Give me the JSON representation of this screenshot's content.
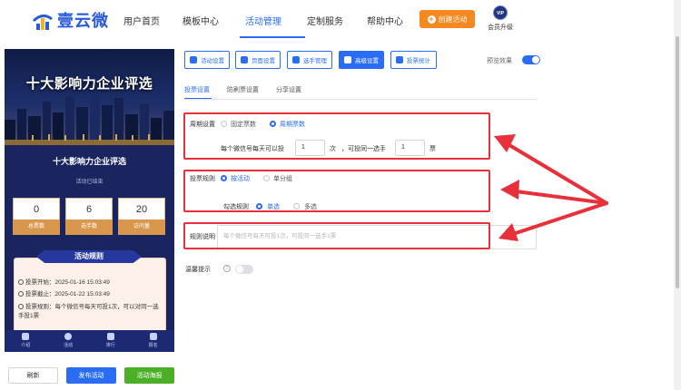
{
  "brand": {
    "name": "壹云微"
  },
  "nav": {
    "items": [
      "用户首页",
      "模板中心",
      "活动管理",
      "定制服务",
      "帮助中心"
    ],
    "active_index": 2,
    "create_label": "创建活动",
    "vip_badge": "VIP",
    "vip_label": "会员升级"
  },
  "preview": {
    "hero_title": "十大影响力企业评选",
    "subtitle": "十大影响力企业评选",
    "status": "活动已结束",
    "stats": [
      {
        "value": "0",
        "label": "总票数"
      },
      {
        "value": "6",
        "label": "选手数"
      },
      {
        "value": "20",
        "label": "访问量"
      }
    ],
    "rules_title": "活动规则",
    "rules": [
      "投票开始：2025-01-16 15:03:49",
      "投票截止：2025-01-22 15:03:49",
      "投票规则：每个微信号每天可投1次，可以对同一选手投1票"
    ],
    "tabs": [
      "介绍",
      "活动",
      "排行",
      "报名"
    ],
    "colors": {
      "accent": "#26389d",
      "stat_label": "#d9974d"
    }
  },
  "bottom_buttons": {
    "refresh": "刷新",
    "publish": "发布活动",
    "poster": "活动海报"
  },
  "toolbar": {
    "buttons": [
      {
        "label": "活动设置",
        "icon": "gear-icon"
      },
      {
        "label": "页面设置",
        "icon": "gear-icon"
      },
      {
        "label": "选手管理",
        "icon": "users-icon"
      },
      {
        "label": "高级设置",
        "icon": "sliders-icon"
      },
      {
        "label": "投票统计",
        "icon": "bar-chart-icon"
      }
    ],
    "active_index": 3,
    "preview_toggle_label": "预览效果",
    "preview_toggle_on": true
  },
  "subtabs": {
    "items": [
      "投票设置",
      "防刷票设置",
      "分享设置"
    ],
    "active_index": 0
  },
  "form": {
    "period": {
      "label": "周期设置",
      "options": [
        "固定票数",
        "周期票数"
      ],
      "selected": 1,
      "text_before": "每个微信号每天可以投",
      "times_value": "1",
      "times_unit": "次",
      "text_middle": "，可投同一选手",
      "votes_value": "1",
      "votes_unit": "票"
    },
    "vote_rule": {
      "label": "投票规则",
      "options": [
        "按活动",
        "单分组"
      ],
      "selected": 0,
      "check_label": "勾选规则",
      "check_options": [
        "单选",
        "多选"
      ],
      "check_selected": 0
    },
    "rule_desc": {
      "label": "规则说明",
      "placeholder": "每个微信号每天可投1次，可投同一选手1票"
    },
    "tip": {
      "label": "温馨提示",
      "help": "?",
      "on": false
    }
  },
  "colors": {
    "primary": "#2a6df4",
    "orange": "#f5891f",
    "green": "#4caf28",
    "annotation_red": "#e8303a"
  }
}
